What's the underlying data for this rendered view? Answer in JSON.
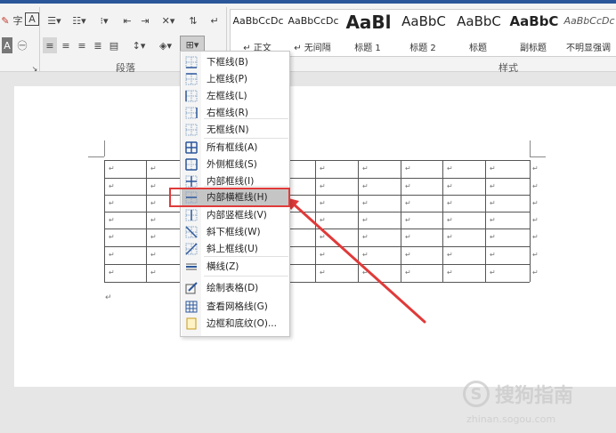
{
  "ribbon": {
    "paragraph_group_label": "段落",
    "styles_group_label": "样式",
    "styles": [
      {
        "sample": "AaBbCcDc",
        "name": "↵ 正文",
        "size": 11
      },
      {
        "sample": "AaBbCcDc",
        "name": "↵ 无间隔",
        "size": 11
      },
      {
        "sample": "AaBl",
        "name": "标题 1",
        "size": 20
      },
      {
        "sample": "AaBbC",
        "name": "标题 2",
        "size": 15
      },
      {
        "sample": "AaBbC",
        "name": "标题",
        "size": 15
      },
      {
        "sample": "AaBbC",
        "name": "副标题",
        "size": 15
      },
      {
        "sample": "AaBbCcDc",
        "name": "不明显强调",
        "size": 11
      }
    ]
  },
  "border_menu": {
    "items": [
      {
        "label": "下框线(B)",
        "icon": "border-bottom-icon"
      },
      {
        "label": "上框线(P)",
        "icon": "border-top-icon"
      },
      {
        "label": "左框线(L)",
        "icon": "border-left-icon"
      },
      {
        "label": "右框线(R)",
        "icon": "border-right-icon"
      },
      {
        "label": "无框线(N)",
        "icon": "no-border-icon"
      },
      {
        "label": "所有框线(A)",
        "icon": "all-borders-icon"
      },
      {
        "label": "外侧框线(S)",
        "icon": "outside-borders-icon"
      },
      {
        "label": "内部框线(I)",
        "icon": "inside-borders-icon"
      },
      {
        "label": "内部横框线(H)",
        "icon": "inside-horizontal-border-icon"
      },
      {
        "label": "内部竖框线(V)",
        "icon": "inside-vertical-border-icon"
      },
      {
        "label": "斜下框线(W)",
        "icon": "diagonal-down-border-icon"
      },
      {
        "label": "斜上框线(U)",
        "icon": "diagonal-up-border-icon"
      },
      {
        "label": "横线(Z)",
        "icon": "horizontal-line-icon"
      },
      {
        "label": "绘制表格(D)",
        "icon": "draw-table-icon"
      },
      {
        "label": "查看网格线(G)",
        "icon": "view-gridlines-icon"
      },
      {
        "label": "边框和底纹(O)...",
        "icon": "borders-shading-icon"
      }
    ],
    "highlighted": "内部横框线(H)"
  },
  "document": {
    "cell_mark": "↵",
    "paragraph_mark": "↵",
    "rows": 7,
    "cols": 10
  },
  "watermark": {
    "text": "搜狗指南",
    "subtext": "zhinan.sogou.com"
  },
  "annotation": {
    "color": "#e03a3a"
  }
}
